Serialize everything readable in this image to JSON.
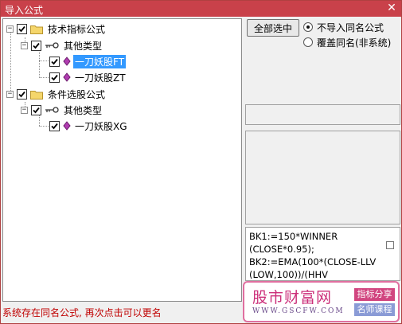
{
  "window": {
    "title": "导入公式",
    "close_label": "✕"
  },
  "tree": {
    "nodes": [
      {
        "label": "技术指标公式"
      },
      {
        "label": "其他类型"
      },
      {
        "label": "一刀妖股FT"
      },
      {
        "label": "一刀妖股ZT"
      },
      {
        "label": "条件选股公式"
      },
      {
        "label": "其他类型"
      },
      {
        "label": "一刀妖股XG"
      }
    ],
    "expander_symbol": "−"
  },
  "right_panel": {
    "select_all_label": "全部选中",
    "radio_options": [
      {
        "label": "不导入同名公式",
        "checked": true
      },
      {
        "label": "覆盖同名(非系统)",
        "checked": false
      }
    ],
    "code_lines": [
      "BK1:=150*WINNER",
      "(CLOSE*0.95);",
      "BK2:=EMA(100*(CLOSE-LLV",
      "(LOW,100))/(HHV"
    ]
  },
  "watermark": {
    "name": "股市财富网",
    "url": "WWW.GSCFW.COM",
    "tag1": "指标分享",
    "tag2": "名师课程"
  },
  "status": {
    "message": "系统存在同名公式, 再次点击可以更名"
  }
}
